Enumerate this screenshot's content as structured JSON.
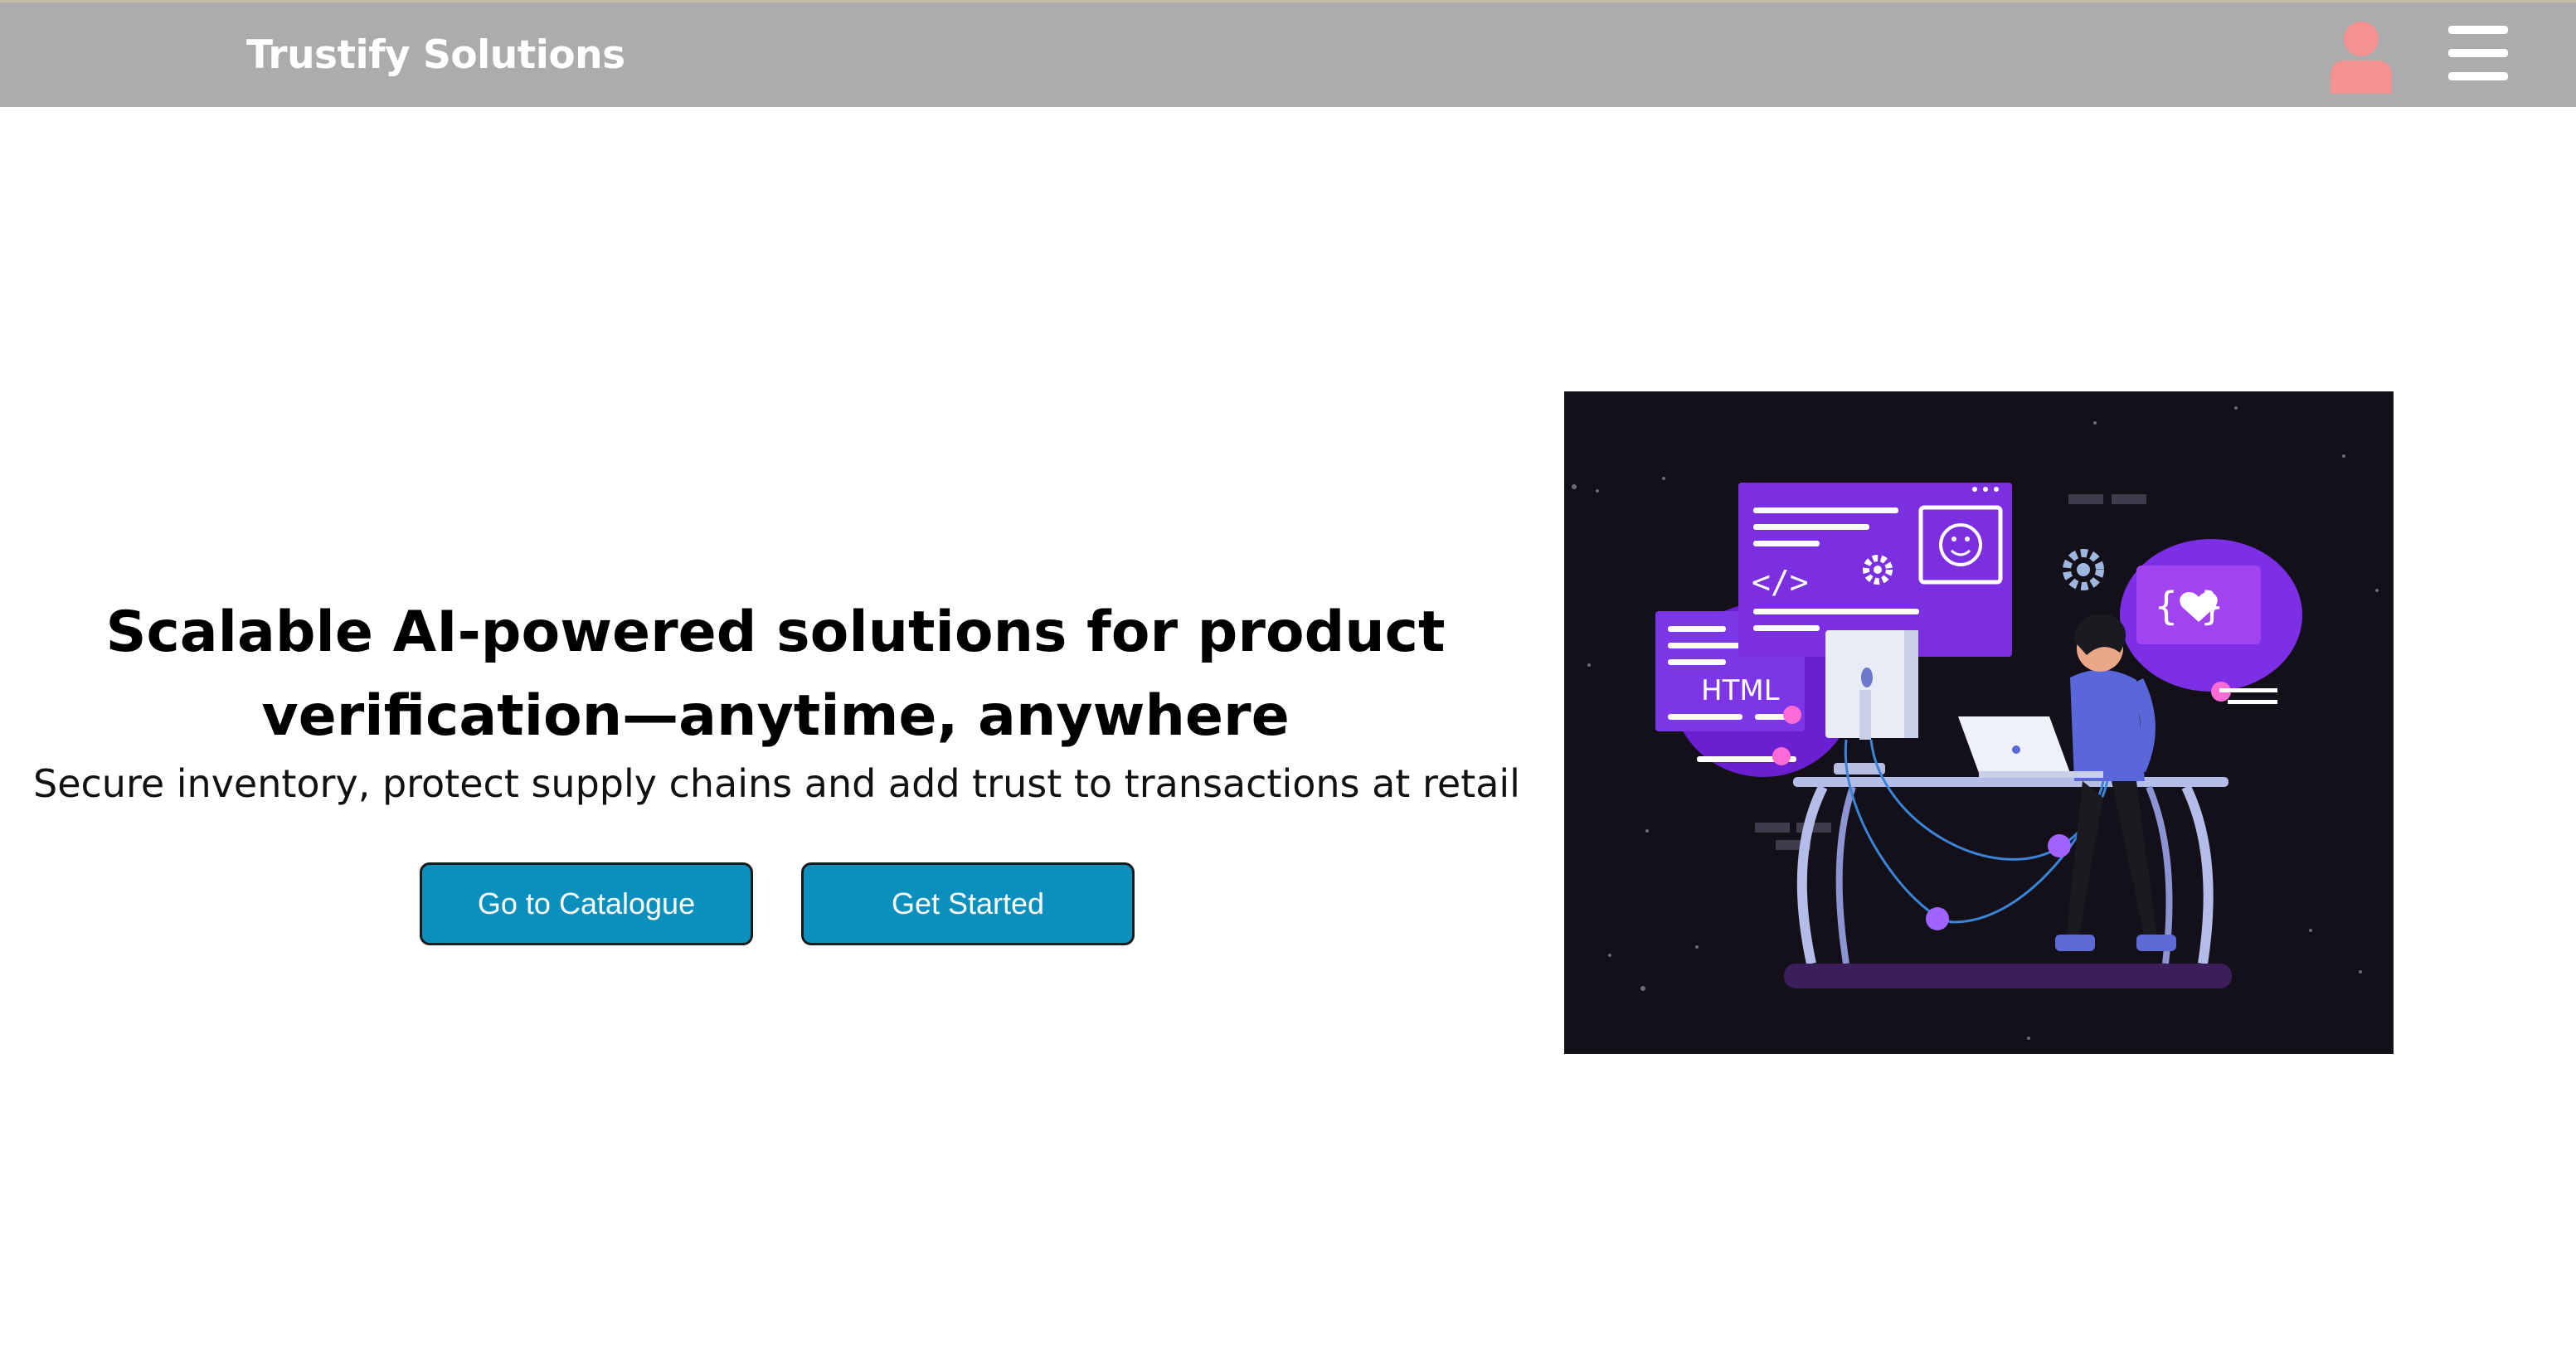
{
  "header": {
    "brand": "Trustify Solutions",
    "user_icon": "user-icon",
    "menu_icon": "hamburger-menu-icon",
    "user_icon_color": "#f49191",
    "background_color": "#acacac"
  },
  "hero": {
    "title": "Scalable AI-powered solutions for product verification—anytime, anywhere",
    "subtitle": "Secure inventory, protect supply chains and add trust to transactions at retail"
  },
  "buttons": {
    "catalogue_label": "Go to Catalogue",
    "get_started_label": "Get Started",
    "color": "#0b8fbd"
  },
  "illustration": {
    "html_label": "HTML",
    "code_symbol": "</>",
    "brace_symbol": "{ }",
    "background_color": "#131019",
    "accent_color": "#7b2fe0"
  }
}
